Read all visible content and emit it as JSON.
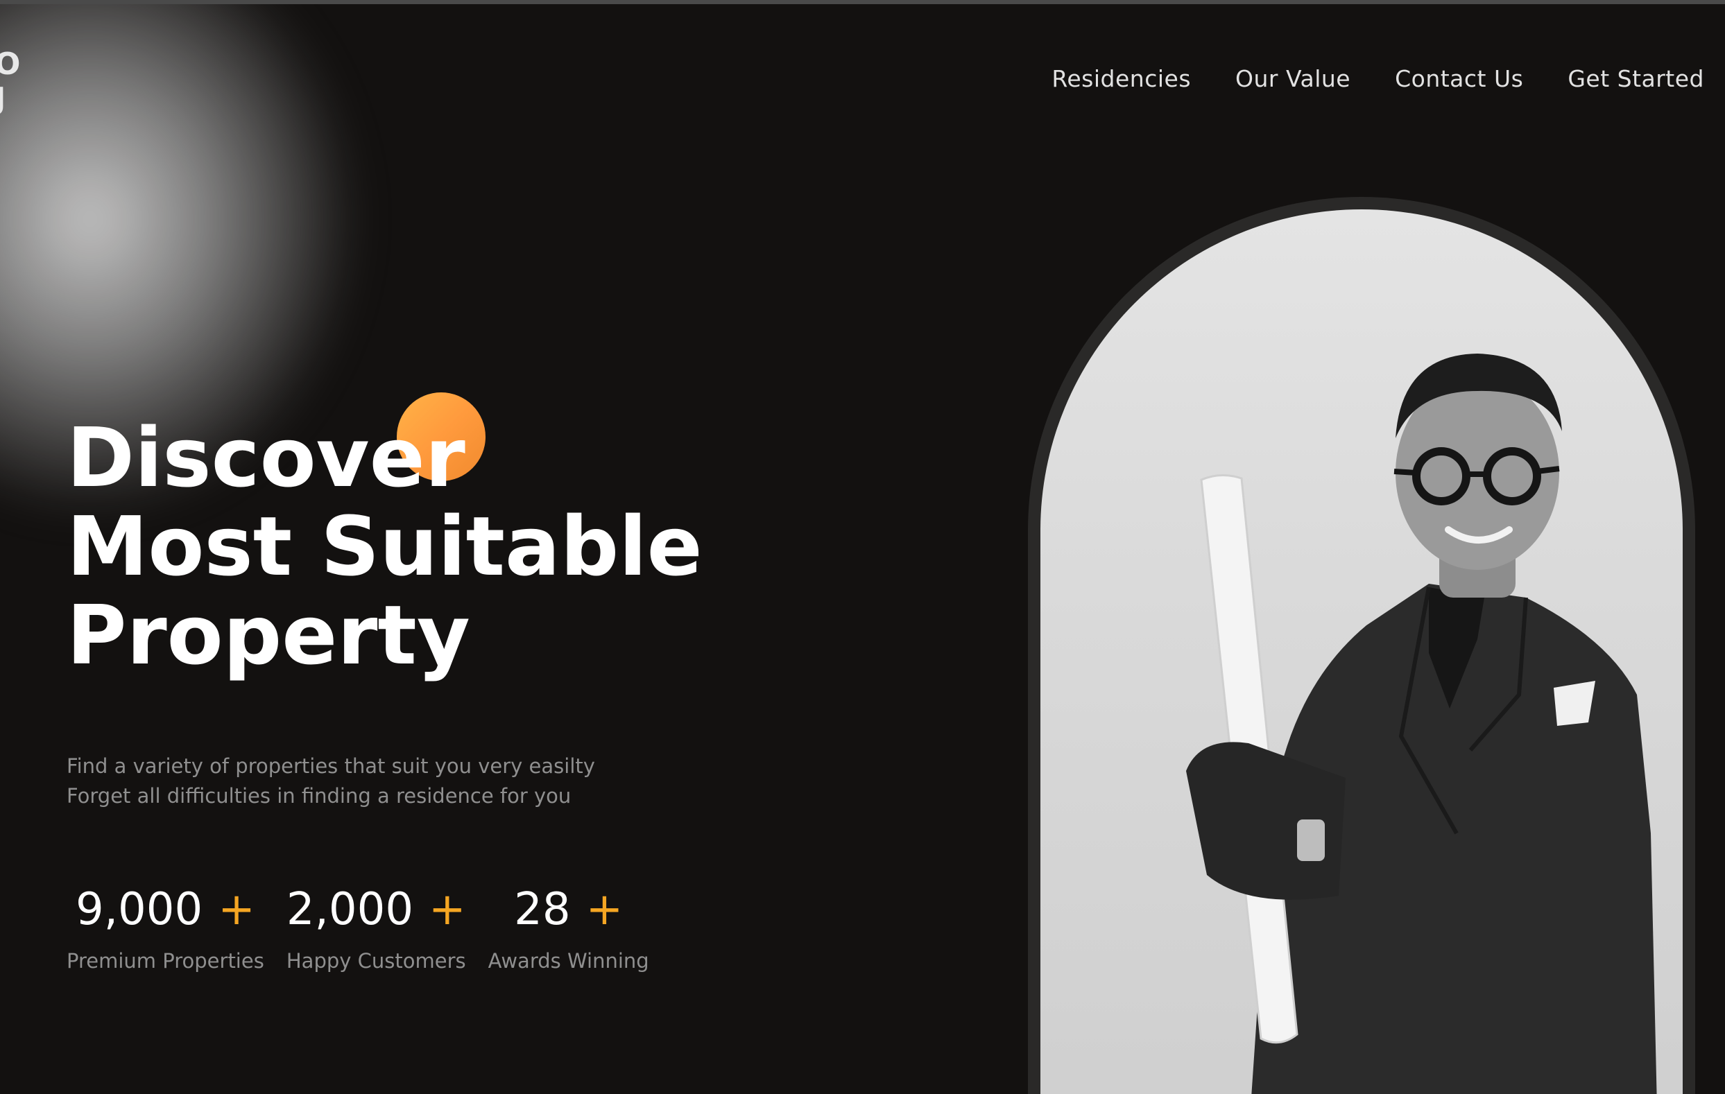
{
  "logo": {
    "line1": "O",
    "line2": "J"
  },
  "nav": {
    "items": [
      "Residencies",
      "Our Value",
      "Contact Us",
      "Get Started"
    ]
  },
  "hero": {
    "title_lines": [
      "Discover",
      "Most Suitable",
      "Property"
    ],
    "subtitle_lines": [
      "Find a variety of properties that suit you very easilty",
      "Forget all difficulties in finding a residence for you"
    ]
  },
  "stats": [
    {
      "value": "9,000",
      "suffix": "+",
      "label": "Premium Properties"
    },
    {
      "value": "2,000",
      "suffix": "+",
      "label": "Happy Customers"
    },
    {
      "value": "28",
      "suffix": "+",
      "label": "Awards Winning"
    }
  ],
  "colors": {
    "background": "#131110",
    "accent": "#f5a623",
    "orange_circle": "#ff9a3d",
    "muted_text": "#8f8f8f"
  }
}
